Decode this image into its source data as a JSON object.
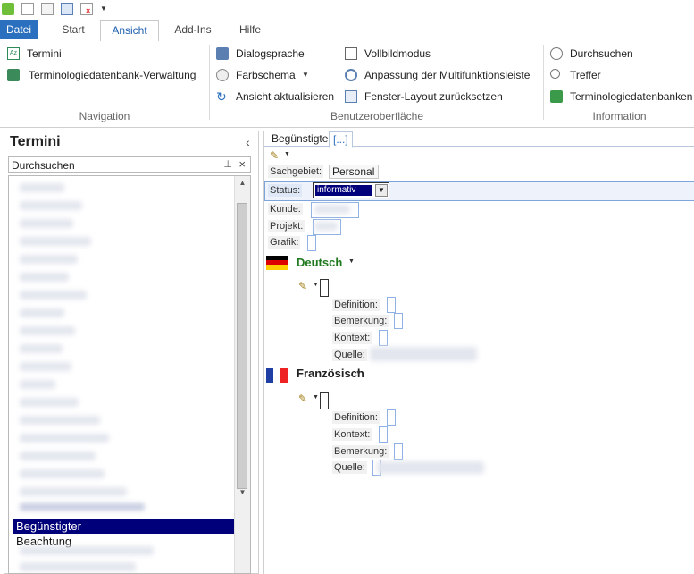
{
  "quick_access": {
    "icons": [
      "app-icon",
      "new-document-icon",
      "edit-document-icon",
      "save-document-icon",
      "delete-document-icon",
      "customize-arrow-icon"
    ]
  },
  "ribbon_tabs": [
    {
      "label": "Datei"
    },
    {
      "label": "Start"
    },
    {
      "label": "Ansicht"
    },
    {
      "label": "Add-Ins"
    },
    {
      "label": "Hilfe"
    }
  ],
  "ribbon": {
    "navigation": {
      "group_label": "Navigation",
      "items": [
        {
          "label": "Termini",
          "icon": "termini-icon"
        },
        {
          "label": "Terminologiedatenbank-Verwaltung",
          "icon": "termbase-management-icon"
        }
      ]
    },
    "ui": {
      "group_label": "Benutzeroberfläche",
      "items": [
        {
          "label": "Dialogsprache",
          "icon": "dialog-language-icon"
        },
        {
          "label": "Farbschema",
          "icon": "color-scheme-icon",
          "has_dropdown": true
        },
        {
          "label": "Ansicht aktualisieren",
          "icon": "refresh-icon"
        },
        {
          "label": "Vollbildmodus",
          "icon": "fullscreen-icon"
        },
        {
          "label": "Anpassung der Multifunktionsleiste",
          "icon": "ribbon-customize-icon"
        },
        {
          "label": "Fenster-Layout zurücksetzen",
          "icon": "reset-layout-icon"
        }
      ]
    },
    "information": {
      "group_label": "Information",
      "items": [
        {
          "label": "Durchsuchen",
          "icon": "browse-icon"
        },
        {
          "label": "Treffer",
          "icon": "hits-icon"
        },
        {
          "label": "Terminologiedatenbanken",
          "icon": "termbases-icon"
        }
      ]
    }
  },
  "left_pane": {
    "title": "Termini",
    "search_label": "Durchsuchen",
    "selected_term": "Begünstigter",
    "next_term": "Beachtung"
  },
  "right_pane": {
    "tabs": [
      "Begünstigter",
      "[...]"
    ],
    "fields": {
      "sachgebiet_label": "Sachgebiet:",
      "sachgebiet_value": "Personal",
      "status_label": "Status:",
      "status_value": "informativ",
      "kunde_label": "Kunde:",
      "projekt_label": "Projekt:",
      "grafik_label": "Grafik:"
    },
    "languages": [
      {
        "name": "Deutsch",
        "color": "#1f7a1f",
        "fields": [
          "Definition:",
          "Bemerkung:",
          "Kontext:",
          "Quelle:"
        ]
      },
      {
        "name": "Französisch",
        "color": "#222222",
        "fields": [
          "Definition:",
          "Kontext:",
          "Bemerkung:",
          "Quelle:"
        ]
      }
    ]
  },
  "colors": {
    "file_tab": "#2b6fbf",
    "active_tab_text": "#1e5fae",
    "selection": "#00007a"
  }
}
